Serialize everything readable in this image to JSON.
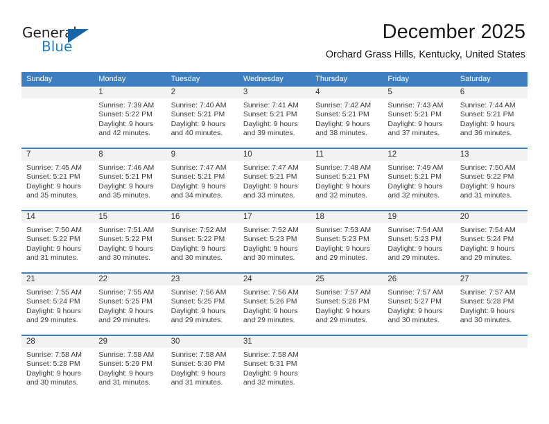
{
  "brand": {
    "name_part1": "General",
    "name_part2": "Blue",
    "accent_color": "#1565a8",
    "text_color": "#231f20"
  },
  "header": {
    "month_title": "December 2025",
    "location": "Orchard Grass Hills, Kentucky, United States"
  },
  "calendar": {
    "header_bg": "#3d7fc1",
    "day_band_bg": "#f2f2f2",
    "weekdays": [
      "Sunday",
      "Monday",
      "Tuesday",
      "Wednesday",
      "Thursday",
      "Friday",
      "Saturday"
    ],
    "weeks": [
      [
        {
          "day": "",
          "lines": []
        },
        {
          "day": "1",
          "lines": [
            "Sunrise: 7:39 AM",
            "Sunset: 5:22 PM",
            "Daylight: 9 hours",
            "and 42 minutes."
          ]
        },
        {
          "day": "2",
          "lines": [
            "Sunrise: 7:40 AM",
            "Sunset: 5:21 PM",
            "Daylight: 9 hours",
            "and 40 minutes."
          ]
        },
        {
          "day": "3",
          "lines": [
            "Sunrise: 7:41 AM",
            "Sunset: 5:21 PM",
            "Daylight: 9 hours",
            "and 39 minutes."
          ]
        },
        {
          "day": "4",
          "lines": [
            "Sunrise: 7:42 AM",
            "Sunset: 5:21 PM",
            "Daylight: 9 hours",
            "and 38 minutes."
          ]
        },
        {
          "day": "5",
          "lines": [
            "Sunrise: 7:43 AM",
            "Sunset: 5:21 PM",
            "Daylight: 9 hours",
            "and 37 minutes."
          ]
        },
        {
          "day": "6",
          "lines": [
            "Sunrise: 7:44 AM",
            "Sunset: 5:21 PM",
            "Daylight: 9 hours",
            "and 36 minutes."
          ]
        }
      ],
      [
        {
          "day": "7",
          "lines": [
            "Sunrise: 7:45 AM",
            "Sunset: 5:21 PM",
            "Daylight: 9 hours",
            "and 35 minutes."
          ]
        },
        {
          "day": "8",
          "lines": [
            "Sunrise: 7:46 AM",
            "Sunset: 5:21 PM",
            "Daylight: 9 hours",
            "and 35 minutes."
          ]
        },
        {
          "day": "9",
          "lines": [
            "Sunrise: 7:47 AM",
            "Sunset: 5:21 PM",
            "Daylight: 9 hours",
            "and 34 minutes."
          ]
        },
        {
          "day": "10",
          "lines": [
            "Sunrise: 7:47 AM",
            "Sunset: 5:21 PM",
            "Daylight: 9 hours",
            "and 33 minutes."
          ]
        },
        {
          "day": "11",
          "lines": [
            "Sunrise: 7:48 AM",
            "Sunset: 5:21 PM",
            "Daylight: 9 hours",
            "and 32 minutes."
          ]
        },
        {
          "day": "12",
          "lines": [
            "Sunrise: 7:49 AM",
            "Sunset: 5:21 PM",
            "Daylight: 9 hours",
            "and 32 minutes."
          ]
        },
        {
          "day": "13",
          "lines": [
            "Sunrise: 7:50 AM",
            "Sunset: 5:22 PM",
            "Daylight: 9 hours",
            "and 31 minutes."
          ]
        }
      ],
      [
        {
          "day": "14",
          "lines": [
            "Sunrise: 7:50 AM",
            "Sunset: 5:22 PM",
            "Daylight: 9 hours",
            "and 31 minutes."
          ]
        },
        {
          "day": "15",
          "lines": [
            "Sunrise: 7:51 AM",
            "Sunset: 5:22 PM",
            "Daylight: 9 hours",
            "and 30 minutes."
          ]
        },
        {
          "day": "16",
          "lines": [
            "Sunrise: 7:52 AM",
            "Sunset: 5:22 PM",
            "Daylight: 9 hours",
            "and 30 minutes."
          ]
        },
        {
          "day": "17",
          "lines": [
            "Sunrise: 7:52 AM",
            "Sunset: 5:23 PM",
            "Daylight: 9 hours",
            "and 30 minutes."
          ]
        },
        {
          "day": "18",
          "lines": [
            "Sunrise: 7:53 AM",
            "Sunset: 5:23 PM",
            "Daylight: 9 hours",
            "and 29 minutes."
          ]
        },
        {
          "day": "19",
          "lines": [
            "Sunrise: 7:54 AM",
            "Sunset: 5:23 PM",
            "Daylight: 9 hours",
            "and 29 minutes."
          ]
        },
        {
          "day": "20",
          "lines": [
            "Sunrise: 7:54 AM",
            "Sunset: 5:24 PM",
            "Daylight: 9 hours",
            "and 29 minutes."
          ]
        }
      ],
      [
        {
          "day": "21",
          "lines": [
            "Sunrise: 7:55 AM",
            "Sunset: 5:24 PM",
            "Daylight: 9 hours",
            "and 29 minutes."
          ]
        },
        {
          "day": "22",
          "lines": [
            "Sunrise: 7:55 AM",
            "Sunset: 5:25 PM",
            "Daylight: 9 hours",
            "and 29 minutes."
          ]
        },
        {
          "day": "23",
          "lines": [
            "Sunrise: 7:56 AM",
            "Sunset: 5:25 PM",
            "Daylight: 9 hours",
            "and 29 minutes."
          ]
        },
        {
          "day": "24",
          "lines": [
            "Sunrise: 7:56 AM",
            "Sunset: 5:26 PM",
            "Daylight: 9 hours",
            "and 29 minutes."
          ]
        },
        {
          "day": "25",
          "lines": [
            "Sunrise: 7:57 AM",
            "Sunset: 5:26 PM",
            "Daylight: 9 hours",
            "and 29 minutes."
          ]
        },
        {
          "day": "26",
          "lines": [
            "Sunrise: 7:57 AM",
            "Sunset: 5:27 PM",
            "Daylight: 9 hours",
            "and 30 minutes."
          ]
        },
        {
          "day": "27",
          "lines": [
            "Sunrise: 7:57 AM",
            "Sunset: 5:28 PM",
            "Daylight: 9 hours",
            "and 30 minutes."
          ]
        }
      ],
      [
        {
          "day": "28",
          "lines": [
            "Sunrise: 7:58 AM",
            "Sunset: 5:28 PM",
            "Daylight: 9 hours",
            "and 30 minutes."
          ]
        },
        {
          "day": "29",
          "lines": [
            "Sunrise: 7:58 AM",
            "Sunset: 5:29 PM",
            "Daylight: 9 hours",
            "and 31 minutes."
          ]
        },
        {
          "day": "30",
          "lines": [
            "Sunrise: 7:58 AM",
            "Sunset: 5:30 PM",
            "Daylight: 9 hours",
            "and 31 minutes."
          ]
        },
        {
          "day": "31",
          "lines": [
            "Sunrise: 7:58 AM",
            "Sunset: 5:31 PM",
            "Daylight: 9 hours",
            "and 32 minutes."
          ]
        },
        {
          "day": "",
          "lines": []
        },
        {
          "day": "",
          "lines": []
        },
        {
          "day": "",
          "lines": []
        }
      ]
    ]
  }
}
